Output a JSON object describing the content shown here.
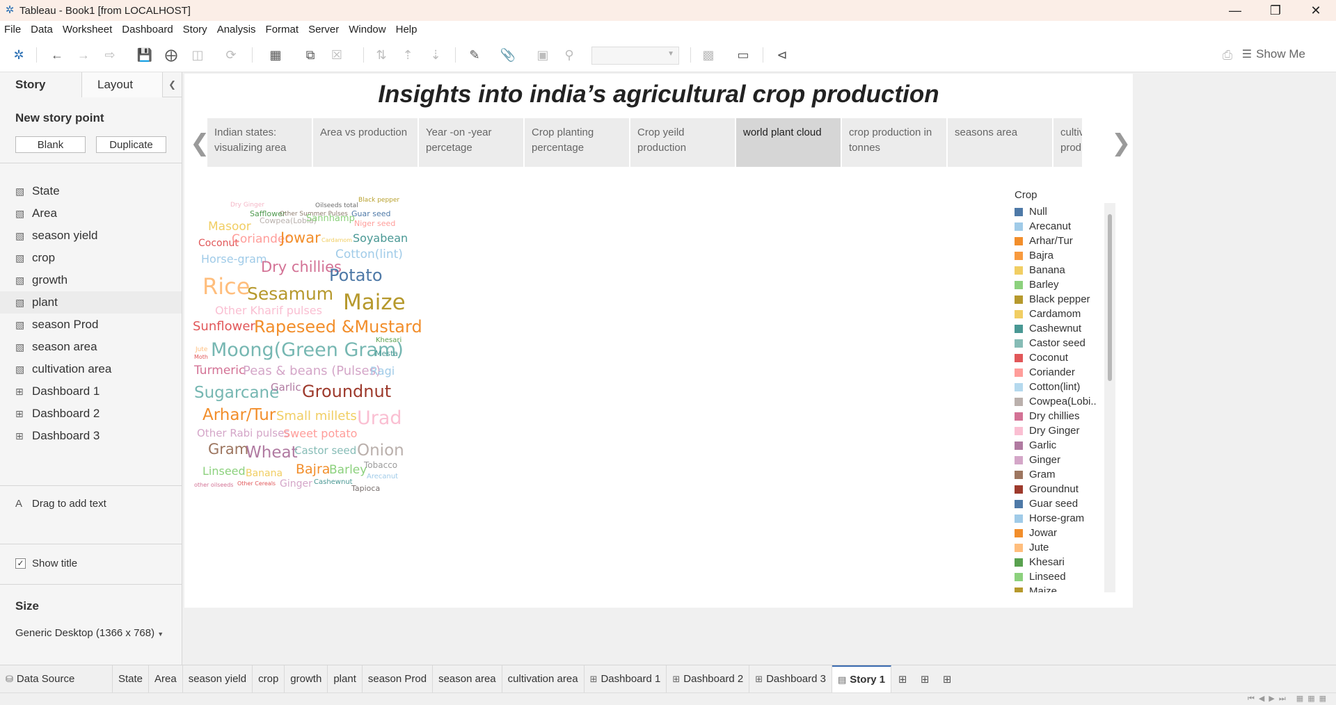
{
  "window": {
    "title": "Tableau - Book1 [from LOCALHOST]"
  },
  "menu": [
    "File",
    "Data",
    "Worksheet",
    "Dashboard",
    "Story",
    "Analysis",
    "Format",
    "Server",
    "Window",
    "Help"
  ],
  "toolbar": {
    "show_me_label": "Show Me"
  },
  "left_pane": {
    "tabs": {
      "story": "Story",
      "layout": "Layout"
    },
    "new_story_point": "New story point",
    "blank_label": "Blank",
    "duplicate_label": "Duplicate",
    "sheets": [
      {
        "label": "State",
        "type": "worksheet"
      },
      {
        "label": "Area",
        "type": "worksheet"
      },
      {
        "label": "season yield",
        "type": "worksheet"
      },
      {
        "label": "crop",
        "type": "worksheet"
      },
      {
        "label": "growth",
        "type": "worksheet"
      },
      {
        "label": "plant",
        "type": "worksheet"
      },
      {
        "label": "season Prod",
        "type": "worksheet"
      },
      {
        "label": "season area",
        "type": "worksheet"
      },
      {
        "label": "cultivation area",
        "type": "worksheet"
      },
      {
        "label": "Dashboard 1",
        "type": "dashboard"
      },
      {
        "label": "Dashboard 2",
        "type": "dashboard"
      },
      {
        "label": "Dashboard 3",
        "type": "dashboard"
      }
    ],
    "drag_text": "Drag to add text",
    "show_title": "Show title",
    "size_label": "Size",
    "size_value": "Generic Desktop (1366 x 768)"
  },
  "story": {
    "title": "Insights into india’s agricultural crop production",
    "points": [
      {
        "label": "Indian  states: visualizing area"
      },
      {
        "label": "Area vs production"
      },
      {
        "label": "Year -on -year percetage"
      },
      {
        "label": "Crop planting percentage"
      },
      {
        "label": "Crop yeild production"
      },
      {
        "label": "world plant cloud",
        "active": true
      },
      {
        "label": "crop production in tonnes"
      },
      {
        "label": "seasons area"
      },
      {
        "label": "cultivation production"
      }
    ]
  },
  "wordcloud": [
    {
      "text": "Dry Ginger",
      "color": "#f4b6c6",
      "size": 9
    },
    {
      "text": "Safflower",
      "color": "#4f9a4f",
      "size": 11
    },
    {
      "text": "Other Summer Pulses",
      "color": "#8d7c6e",
      "size": 9
    },
    {
      "text": "Oilseeds total",
      "color": "#6b6b6b",
      "size": 9
    },
    {
      "text": "Black pepper",
      "color": "#b8a12e",
      "size": 9
    },
    {
      "text": "Masoor",
      "color": "#f1ce63",
      "size": 17
    },
    {
      "text": "Cowpea(Lobia)",
      "color": "#b8b0ac",
      "size": 11
    },
    {
      "text": "Sannhamp",
      "color": "#8cd17d",
      "size": 13
    },
    {
      "text": "Guar seed",
      "color": "#4e79a7",
      "size": 11
    },
    {
      "text": "Niger seed",
      "color": "#ff9d9a",
      "size": 11
    },
    {
      "text": "Coconut",
      "color": "#e15759",
      "size": 14
    },
    {
      "text": "Coriander",
      "color": "#ff9d9a",
      "size": 17
    },
    {
      "text": "Jowar",
      "color": "#f28e2b",
      "size": 21
    },
    {
      "text": "Cardamom",
      "color": "#f1ce63",
      "size": 8
    },
    {
      "text": "Soyabean",
      "color": "#499894",
      "size": 16
    },
    {
      "text": "Horse-gram",
      "color": "#a0cbe8",
      "size": 16
    },
    {
      "text": "Dry chillies",
      "color": "#d37295",
      "size": 21
    },
    {
      "text": "Cotton(lint)",
      "color": "#a0cbe8",
      "size": 17
    },
    {
      "text": "Potato",
      "color": "#4e79a7",
      "size": 24
    },
    {
      "text": "Rice",
      "color": "#ffbe7d",
      "size": 32
    },
    {
      "text": "Sesamum",
      "color": "#b6992d",
      "size": 25
    },
    {
      "text": "Maize",
      "color": "#b6992d",
      "size": 31
    },
    {
      "text": "Other Kharif pulses",
      "color": "#fabfd2",
      "size": 16
    },
    {
      "text": "Sunflower",
      "color": "#e15759",
      "size": 18
    },
    {
      "text": "Rapeseed &Mustard",
      "color": "#f28e2b",
      "size": 24
    },
    {
      "text": "Khesari",
      "color": "#59a14f",
      "size": 10
    },
    {
      "text": "Jute",
      "color": "#ffbe7d",
      "size": 9
    },
    {
      "text": "Moong(Green Gram)",
      "color": "#76b7b2",
      "size": 27
    },
    {
      "text": "Moth",
      "color": "#e15759",
      "size": 8
    },
    {
      "text": "Mesta",
      "color": "#499894",
      "size": 11
    },
    {
      "text": "Turmeric",
      "color": "#d37295",
      "size": 17
    },
    {
      "text": "Peas & beans (Pulses)",
      "color": "#d4a6c8",
      "size": 18
    },
    {
      "text": "Ragi",
      "color": "#a0cbe8",
      "size": 16
    },
    {
      "text": "Sugarcane",
      "color": "#76b7b2",
      "size": 23
    },
    {
      "text": "Garlic",
      "color": "#b07aa1",
      "size": 15
    },
    {
      "text": "Groundnut",
      "color": "#9d3a2c",
      "size": 24
    },
    {
      "text": "Arhar/Tur",
      "color": "#f28e2b",
      "size": 23
    },
    {
      "text": "Small millets",
      "color": "#f1ce63",
      "size": 18
    },
    {
      "text": "Urad",
      "color": "#fabfd2",
      "size": 27
    },
    {
      "text": "Other Rabi pulses",
      "color": "#d4a6c8",
      "size": 15
    },
    {
      "text": "Sweet potato",
      "color": "#ff9d9a",
      "size": 16
    },
    {
      "text": "Gram",
      "color": "#9c755f",
      "size": 21
    },
    {
      "text": "Wheat",
      "color": "#b07aa1",
      "size": 23
    },
    {
      "text": "Castor seed",
      "color": "#86bcb6",
      "size": 15
    },
    {
      "text": "Onion",
      "color": "#bab0ac",
      "size": 23
    },
    {
      "text": "Linseed",
      "color": "#8cd17d",
      "size": 16
    },
    {
      "text": "Banana",
      "color": "#f1ce63",
      "size": 14
    },
    {
      "text": "Bajra",
      "color": "#f28e2b",
      "size": 19
    },
    {
      "text": "Barley",
      "color": "#8cd17d",
      "size": 17
    },
    {
      "text": "Tobacco",
      "color": "#9c9c9c",
      "size": 12
    },
    {
      "text": "Arecanut",
      "color": "#a0cbe8",
      "size": 10
    },
    {
      "text": "other oilseeds",
      "color": "#d37295",
      "size": 8
    },
    {
      "text": "Other Cereals",
      "color": "#e15759",
      "size": 8
    },
    {
      "text": "Ginger",
      "color": "#d4a6c8",
      "size": 14
    },
    {
      "text": "Cashewnut",
      "color": "#499894",
      "size": 10
    },
    {
      "text": "Tapioca",
      "color": "#79706e",
      "size": 11
    }
  ],
  "legend": {
    "title": "Crop",
    "items": [
      {
        "label": "Null",
        "color": "#4e79a7"
      },
      {
        "label": "Arecanut",
        "color": "#a0cbe8"
      },
      {
        "label": "Arhar/Tur",
        "color": "#f28e2b"
      },
      {
        "label": "Bajra",
        "color": "#f89a3e"
      },
      {
        "label": "Banana",
        "color": "#f1ce63"
      },
      {
        "label": "Barley",
        "color": "#8cd17d"
      },
      {
        "label": "Black pepper",
        "color": "#b6992d"
      },
      {
        "label": "Cardamom",
        "color": "#f1ce63"
      },
      {
        "label": "Cashewnut",
        "color": "#499894"
      },
      {
        "label": "Castor seed",
        "color": "#86bcb6"
      },
      {
        "label": "Coconut",
        "color": "#e15759"
      },
      {
        "label": "Coriander",
        "color": "#ff9d9a"
      },
      {
        "label": "Cotton(lint)",
        "color": "#b5d9ee"
      },
      {
        "label": "Cowpea(Lobi..",
        "color": "#bab0ac"
      },
      {
        "label": "Dry chillies",
        "color": "#d37295"
      },
      {
        "label": "Dry Ginger",
        "color": "#fabfd2"
      },
      {
        "label": "Garlic",
        "color": "#b07aa1"
      },
      {
        "label": "Ginger",
        "color": "#d4a6c8"
      },
      {
        "label": "Gram",
        "color": "#9d7660"
      },
      {
        "label": "Groundnut",
        "color": "#9d3a2c"
      },
      {
        "label": "Guar seed",
        "color": "#4e79a7"
      },
      {
        "label": "Horse-gram",
        "color": "#a0cbe8"
      },
      {
        "label": "Jowar",
        "color": "#f28e2b"
      },
      {
        "label": "Jute",
        "color": "#ffbe7d"
      },
      {
        "label": "Khesari",
        "color": "#59a14f"
      },
      {
        "label": "Linseed",
        "color": "#8cd17d"
      },
      {
        "label": "Maize",
        "color": "#b6992d"
      }
    ]
  },
  "bottom_tabs": [
    {
      "label": "Data Source",
      "kind": "datasource"
    },
    {
      "label": "State",
      "kind": "sheet"
    },
    {
      "label": "Area",
      "kind": "sheet"
    },
    {
      "label": "season yield",
      "kind": "sheet"
    },
    {
      "label": "crop",
      "kind": "sheet"
    },
    {
      "label": "growth",
      "kind": "sheet"
    },
    {
      "label": "plant",
      "kind": "sheet"
    },
    {
      "label": "season Prod",
      "kind": "sheet"
    },
    {
      "label": "season area",
      "kind": "sheet"
    },
    {
      "label": "cultivation area",
      "kind": "sheet"
    },
    {
      "label": "Dashboard 1",
      "kind": "dashboard"
    },
    {
      "label": "Dashboard 2",
      "kind": "dashboard"
    },
    {
      "label": "Dashboard 3",
      "kind": "dashboard"
    },
    {
      "label": "Story 1",
      "kind": "story",
      "active": true
    }
  ]
}
